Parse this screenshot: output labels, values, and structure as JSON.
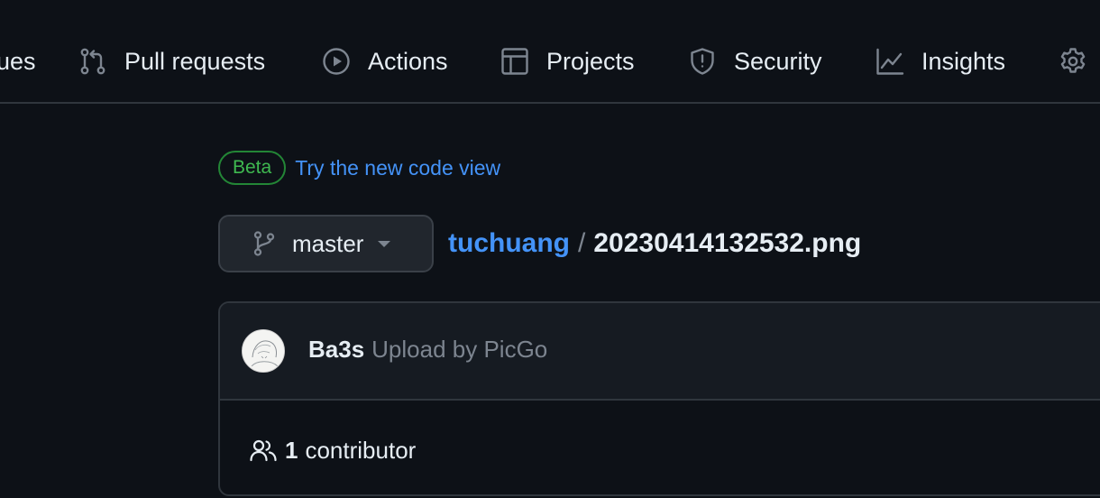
{
  "nav": {
    "issues_label": "ues",
    "pull_requests_label": "Pull requests",
    "actions_label": "Actions",
    "projects_label": "Projects",
    "security_label": "Security",
    "insights_label": "Insights",
    "settings_icon": "gear-icon"
  },
  "beta": {
    "badge": "Beta",
    "link": "Try the new code view"
  },
  "branch": {
    "name": "master"
  },
  "breadcrumb": {
    "repo": "tuchuang",
    "separator": "/",
    "file": "20230414132532.png"
  },
  "commit": {
    "author": "Ba3s",
    "message": "Upload by PicGo"
  },
  "contributors": {
    "count": "1",
    "label": "contributor"
  },
  "colors": {
    "background": "#0d1117",
    "link": "#4493f8",
    "beta_green": "#3fb950"
  }
}
